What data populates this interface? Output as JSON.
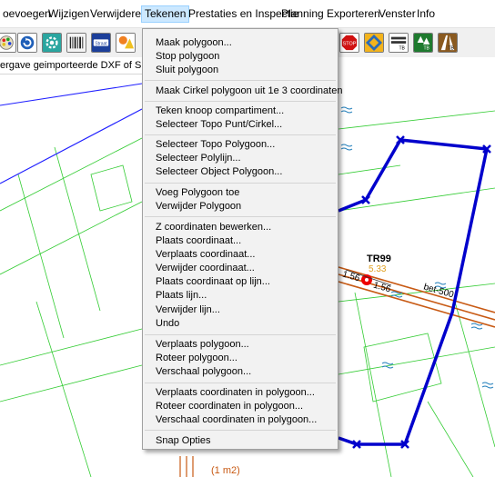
{
  "menubar": {
    "items": [
      {
        "label": "oevoegen"
      },
      {
        "label": "Wijzigen"
      },
      {
        "label": "Verwijderen"
      },
      {
        "label": "Tekenen"
      },
      {
        "label": "Prestaties en Inspectie"
      },
      {
        "label": "Planning"
      },
      {
        "label": "Exporteren"
      },
      {
        "label": "Venster"
      },
      {
        "label": "Info"
      }
    ],
    "active": "Tekenen"
  },
  "toolbar": {
    "left_icons": [
      "palette-icon",
      "rotate-icon",
      "gear-icon",
      "barcode-icon",
      "straat-icon",
      "shapes-icon"
    ],
    "straat_label": "Straat",
    "right_icons": [
      "stop-sign-icon",
      "sign-icon",
      "tb-road-icon",
      "tb-tree-icon",
      "tb-road-alt-icon"
    ],
    "tb_label": "TB"
  },
  "info_strip": {
    "text": "ergave geimporteerde DXF of SHP best"
  },
  "dropdown": {
    "groups": [
      [
        "Maak polygoon...",
        "Stop polygoon",
        "Sluit polygoon"
      ],
      [
        "Maak Cirkel polygoon uit 1e 3 coordinaten"
      ],
      [
        "Teken knoop compartiment...",
        "Selecteer Topo Punt/Cirkel..."
      ],
      [
        "Selecteer Topo Polygoon...",
        "Selecteer Polylijn...",
        "Selecteer Object Polygoon..."
      ],
      [
        "Voeg Polygoon toe",
        "Verwijder Polygoon"
      ],
      [
        "Z coordinaten bewerken...",
        "Plaats coordinaat...",
        "Verplaats coordinaat...",
        "Verwijder coordinaat...",
        "Plaats coordinaat op lijn...",
        "Plaats lijn...",
        "Verwijder lijn...",
        "Undo"
      ],
      [
        "Verplaats polygoon...",
        "Roteer polygoon...",
        "Verschaal polygoon..."
      ],
      [
        "Verplaats coordinaten in polygoon...",
        "Roteer coordinaten in polygoon...",
        "Verschaal coordinaten in polygoon..."
      ],
      [
        "Snap Opties"
      ]
    ]
  },
  "map": {
    "tree_label": "TR99",
    "tree_value": "5.33",
    "dim_left": "1.56",
    "dim_right": "1.56",
    "pipe_label": "bet-500",
    "bottom_label": "(1 m2)",
    "colors": {
      "polygon": "#0000cc",
      "pipe": "#c85a14",
      "tree": "#ee0000",
      "grid": "#33cc33",
      "water": "#1a7ab8"
    }
  }
}
